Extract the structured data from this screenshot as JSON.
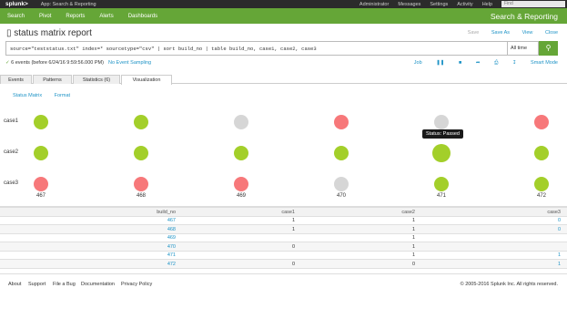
{
  "topbar": {
    "logo": "splunk>",
    "app_menu": "App: Search & Reporting",
    "menus": [
      "Administrator",
      "Messages",
      "Settings",
      "Activity",
      "Help"
    ],
    "find_placeholder": "Find"
  },
  "appbar": {
    "nav": [
      "Search",
      "Pivot",
      "Reports",
      "Alerts",
      "Dashboards"
    ],
    "app_title": "Search & Reporting"
  },
  "report": {
    "title": "status matrix report",
    "actions": {
      "edit": "Save",
      "save_as": "Save As",
      "view": "View",
      "close": "Close"
    }
  },
  "search": {
    "query": "source=\"teststatus.txt\" index=* sourcetype=\"csv\" | sort build_no | table build_no, case1, case2, case3",
    "time_range": "All time",
    "button_icon": "search-icon"
  },
  "status": {
    "events": "6 events (before 6/24/16 9:59:56.000 PM)",
    "sampling": "No Event Sampling",
    "job": "Job",
    "smart_mode": "Smart Mode"
  },
  "tabs": [
    "Events",
    "Patterns",
    "Statistics (6)",
    "Visualization"
  ],
  "viz_controls": {
    "type": "Status Matrix",
    "format": "Format"
  },
  "matrix": {
    "rows": [
      "case1",
      "case2",
      "case3"
    ],
    "columns": [
      "467",
      "468",
      "469",
      "470",
      "471",
      "472"
    ],
    "status": [
      [
        "pass",
        "pass",
        "none",
        "fail",
        "none",
        "fail"
      ],
      [
        "pass",
        "pass",
        "pass",
        "pass",
        "pass",
        "pass"
      ],
      [
        "fail",
        "fail",
        "fail",
        "none",
        "pass",
        "pass"
      ]
    ],
    "colors": {
      "pass": "#a3cf2a",
      "fail": "#f7787a",
      "none": "#d6d6d6"
    },
    "tooltip": "Status: Passed"
  },
  "table": {
    "headers": [
      "build_no",
      "case1",
      "case2",
      "case3"
    ],
    "rows": [
      [
        "467",
        "1",
        "1",
        "0"
      ],
      [
        "468",
        "1",
        "1",
        "0"
      ],
      [
        "469",
        "",
        "1",
        ""
      ],
      [
        "470",
        "0",
        "1",
        ""
      ],
      [
        "471",
        "",
        "1",
        "1"
      ],
      [
        "472",
        "0",
        "0",
        "1"
      ]
    ]
  },
  "footer": {
    "links": [
      "About",
      "Support",
      "File a Bug",
      "Documentation",
      "Privacy Policy"
    ],
    "copyright": "© 2005-2016 Splunk Inc. All rights reserved."
  }
}
